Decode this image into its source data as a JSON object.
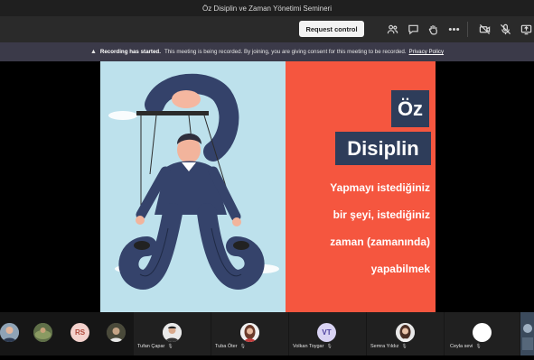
{
  "window": {
    "title": "Öz Disiplin ve Zaman Yönetimi Semineri"
  },
  "toolbar": {
    "request_control_label": "Request control",
    "icons": [
      "people-icon",
      "chat-icon",
      "raise-hand-icon",
      "more-icon",
      "camera-off-icon",
      "mic-off-icon",
      "share-icon"
    ]
  },
  "banner": {
    "title": "Recording has started.",
    "message": "This meeting is being recorded. By joining, you are giving consent for this meeting to be recorded.",
    "link": "Privacy Policy"
  },
  "slide": {
    "word1": "Öz",
    "word2": "Disiplin",
    "lines": [
      "Yapmayı istediğiniz",
      "bir şeyi, istediğiniz",
      "zaman (zamanında)",
      "yapabilmek"
    ],
    "colors": {
      "left_bg": "#bde1ec",
      "right_bg": "#f5563f",
      "box": "#2e3d5a"
    }
  },
  "participants": {
    "avatars": [
      {
        "initials": ""
      },
      {
        "initials": ""
      },
      {
        "initials": "RS"
      },
      {
        "initials": ""
      }
    ],
    "named": [
      {
        "name": "Tufan Çapar",
        "initials": ""
      },
      {
        "name": "Tuba Öter",
        "initials": ""
      },
      {
        "name": "Volkan Toygar",
        "initials": "VT"
      },
      {
        "name": "Semra Yıldız",
        "initials": ""
      },
      {
        "name": "Ceyla sevi",
        "initials": ""
      }
    ]
  }
}
